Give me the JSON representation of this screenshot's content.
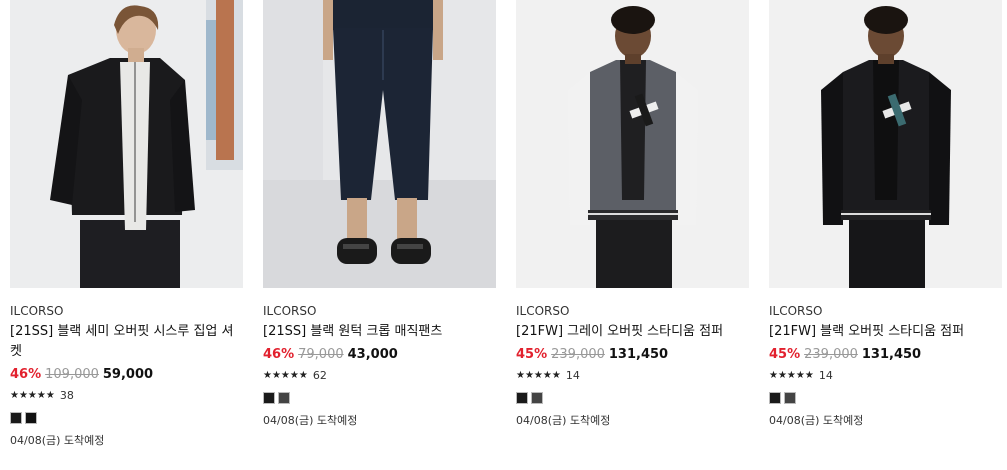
{
  "colors": {
    "discount": "#e2212e",
    "text": "#111111"
  },
  "products": [
    {
      "brand": "ILCORSO",
      "title": "[21SS] 블랙 세미 오버핏 시스루 집업 셔켓",
      "discount": "46%",
      "original_price": "109,000",
      "price": "59,000",
      "stars": "★★★★★",
      "reviews": "38",
      "swatches": [
        "#1a1a1a",
        "#111111"
      ],
      "shipping": "04/08(금) 도착예정"
    },
    {
      "brand": "ILCORSO",
      "title": "[21SS] 블랙 원턱 크롭 매직팬츠",
      "discount": "46%",
      "original_price": "79,000",
      "price": "43,000",
      "stars": "★★★★★",
      "reviews": "62",
      "swatches": [
        "#1a1a1a",
        "#444444"
      ],
      "shipping": "04/08(금) 도착예정"
    },
    {
      "brand": "ILCORSO",
      "title": "[21FW] 그레이 오버핏 스타디움 점퍼",
      "discount": "45%",
      "original_price": "239,000",
      "price": "131,450",
      "stars": "★★★★★",
      "reviews": "14",
      "swatches": [
        "#1a1a1a",
        "#444444"
      ],
      "shipping": "04/08(금) 도착예정"
    },
    {
      "brand": "ILCORSO",
      "title": "[21FW] 블랙 오버핏 스타디움 점퍼",
      "discount": "45%",
      "original_price": "239,000",
      "price": "131,450",
      "stars": "★★★★★",
      "reviews": "14",
      "swatches": [
        "#1a1a1a",
        "#444444"
      ],
      "shipping": "04/08(금) 도착예정"
    }
  ]
}
